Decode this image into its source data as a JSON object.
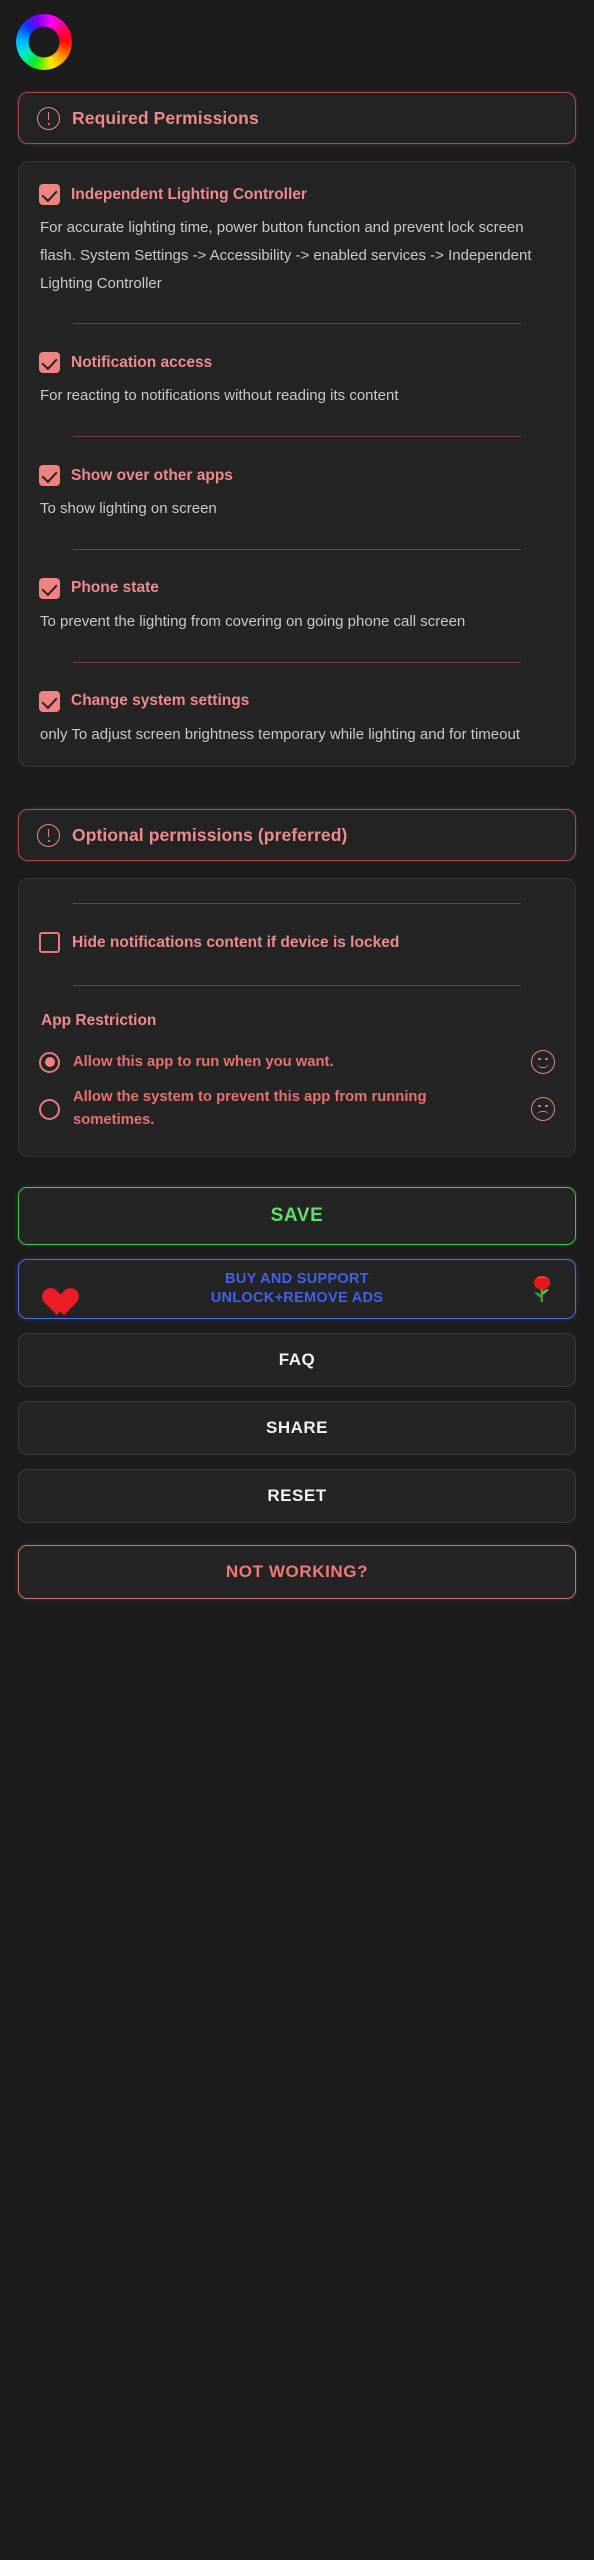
{
  "app": {
    "logo_icon": "rainbow-ring-logo"
  },
  "required_section": {
    "title": "Required Permissions",
    "icon": "exclamation-circle-icon",
    "items": [
      {
        "label": "Independent Lighting Controller",
        "checked": true,
        "description": "For accurate lighting time, power button function and prevent lock screen flash. System Settings -> Accessibility -> enabled services -> Independent Lighting Controller"
      },
      {
        "label": "Notification access",
        "checked": true,
        "description": "For reacting to notifications without reading its content"
      },
      {
        "label": "Show over other apps",
        "checked": true,
        "description": "To show lighting on screen"
      },
      {
        "label": "Phone state",
        "checked": true,
        "description": "To prevent the lighting from covering on going phone call screen"
      },
      {
        "label": "Change system settings",
        "checked": true,
        "description": "only To adjust screen brightness temporary while lighting and for timeout"
      }
    ]
  },
  "optional_section": {
    "title": "Optional permissions (preferred)",
    "icon": "exclamation-circle-icon",
    "hide_notifications": {
      "label": "Hide notifications content if device is locked",
      "checked": false
    },
    "app_restriction": {
      "title": "App Restriction",
      "options": [
        {
          "label": "Allow this app to run when you want.",
          "selected": true,
          "face_icon": "smiling-face-icon"
        },
        {
          "label": "Allow the system to prevent this app from running sometimes.",
          "selected": false,
          "face_icon": "frowning-face-icon"
        }
      ]
    }
  },
  "buttons": {
    "save": "SAVE",
    "buy_line1": "BUY AND SUPPORT",
    "buy_line2": "UNLOCK+REMOVE ADS",
    "buy_left_icon": "red-heart-icon",
    "buy_right_icon": "rose-icon",
    "faq": "FAQ",
    "share": "SHARE",
    "reset": "RESET",
    "not_working": "NOT WORKING?"
  },
  "colors": {
    "background": "#1c1c1c",
    "card": "#242424",
    "accent_red": "#ef8a8a",
    "accent_red_strong": "#e8716e",
    "divider": "#7c3a42",
    "save_green": "#5fe06a",
    "buy_blue": "#3f62e8",
    "text_body": "#c9c9c9"
  }
}
